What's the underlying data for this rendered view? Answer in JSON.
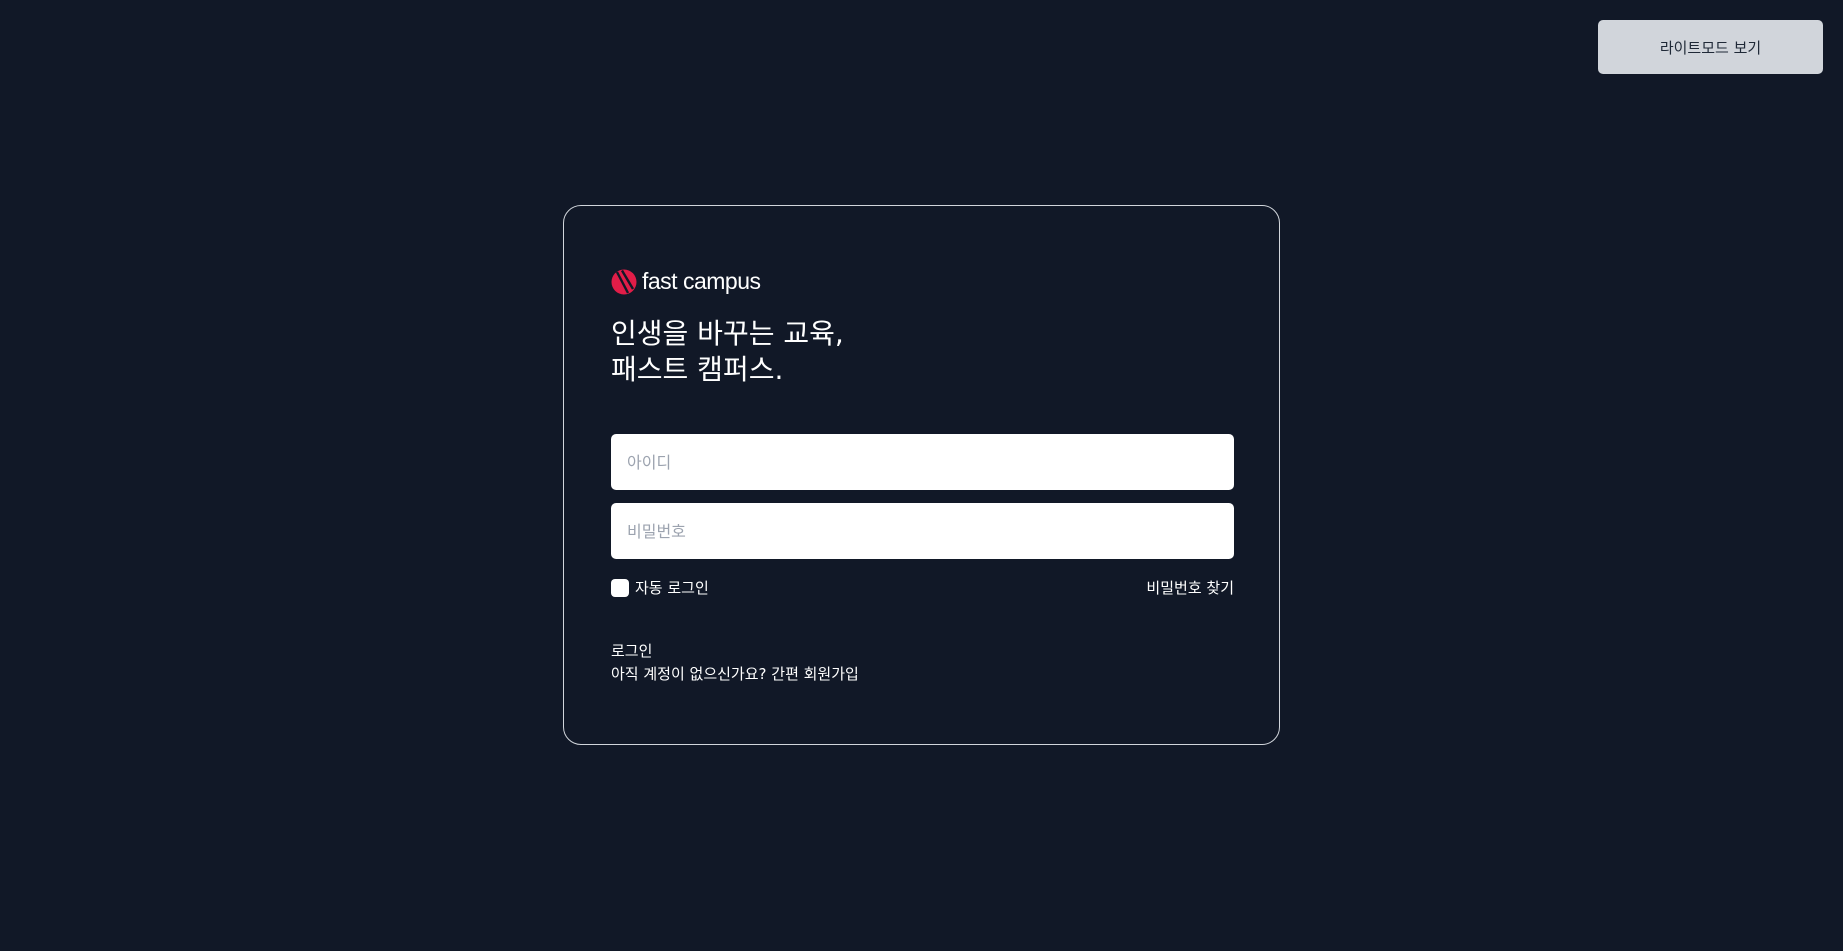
{
  "header": {
    "mode_toggle_label": "라이트모드 보기"
  },
  "logo": {
    "brand_text": "fast campus",
    "brand_color": "#e11d48"
  },
  "headline": {
    "line1": "인생을 바꾸는 교육,",
    "line2": "패스트 캠퍼스."
  },
  "form": {
    "id_placeholder": "아이디",
    "id_value": "",
    "password_placeholder": "비밀번호",
    "password_value": "",
    "autologin_label": "자동 로그인",
    "autologin_checked": false,
    "find_password_label": "비밀번호 찾기",
    "login_label": "로그인",
    "signup_label": "아직 계정이 없으신가요? 간편 회원가입"
  },
  "colors": {
    "background": "#111827",
    "card_border": "#d1d5db",
    "mode_button_bg": "#d1d5db"
  }
}
